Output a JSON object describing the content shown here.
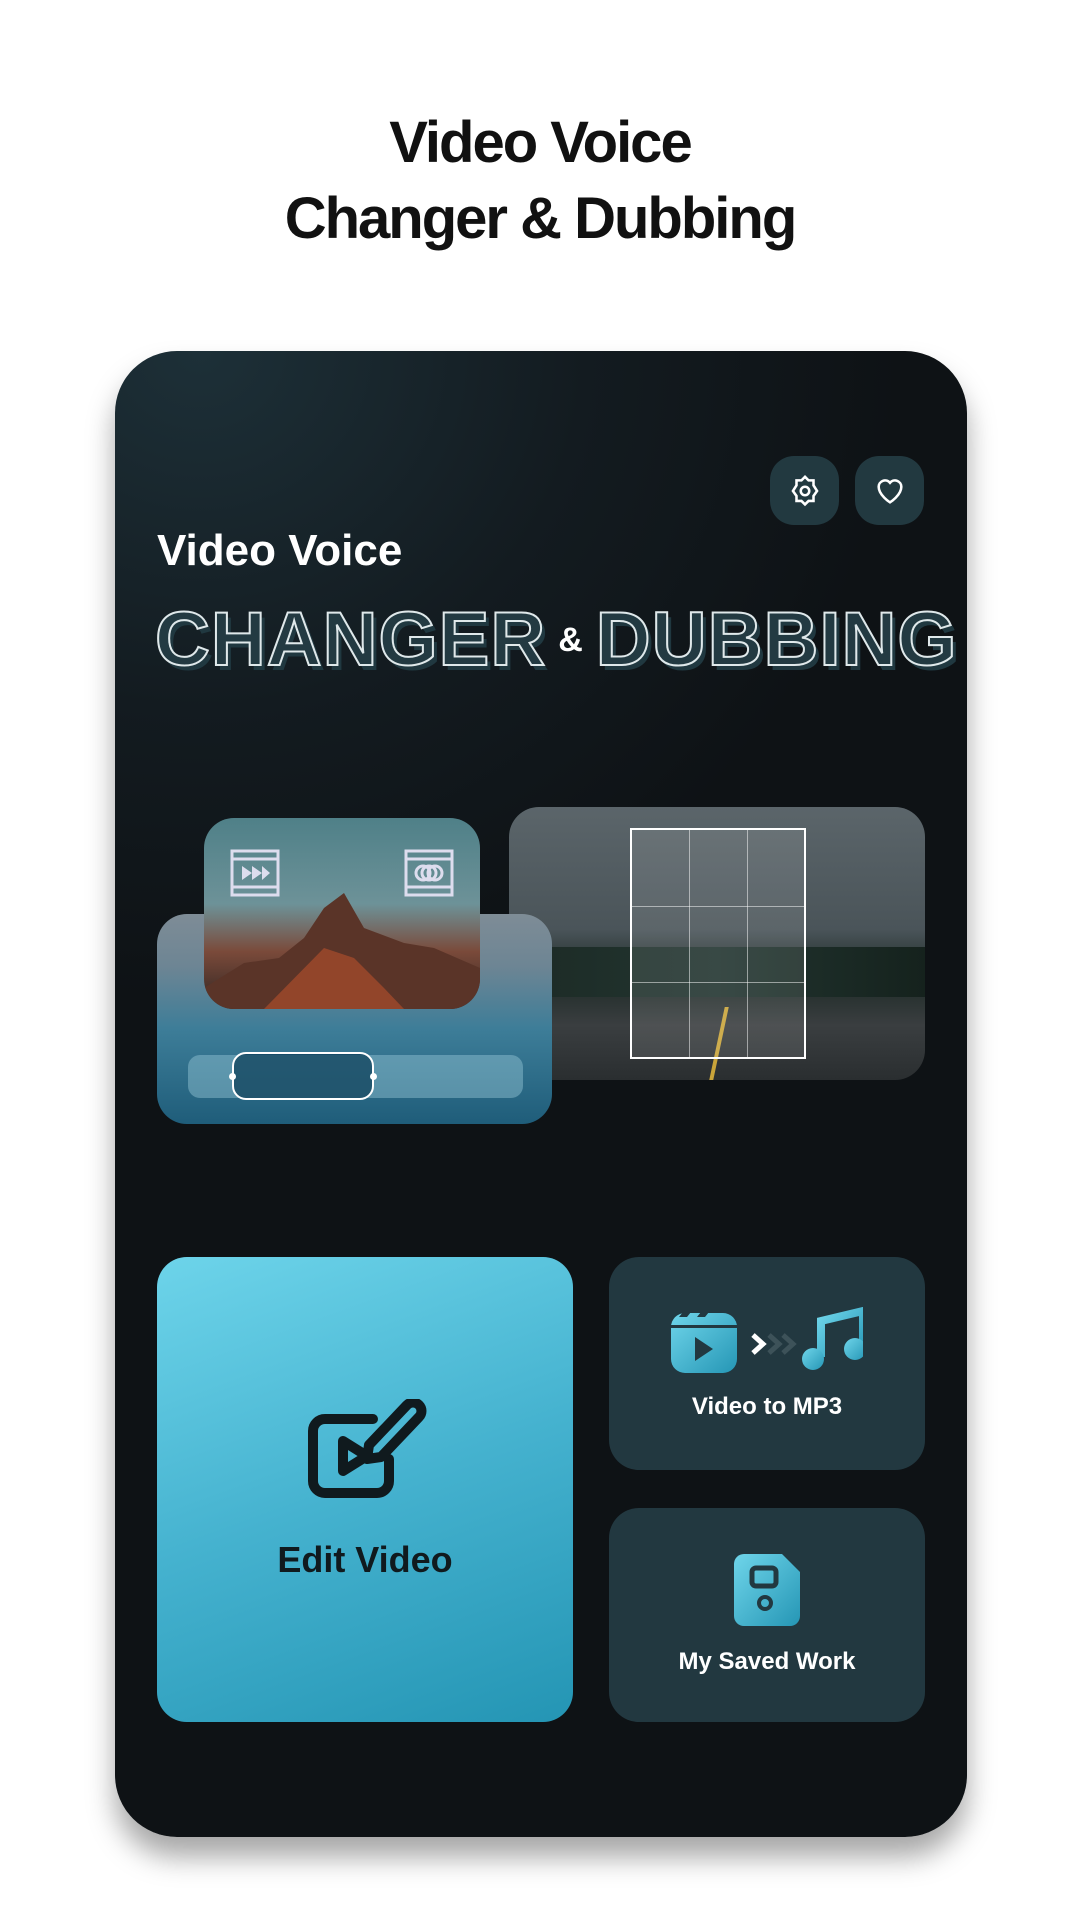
{
  "headline": {
    "line1": "Video Voice",
    "line2": "Changer & Dubbing"
  },
  "app": {
    "title_line1": "Video Voice",
    "title_word1": "CHANGER",
    "title_amp": "&",
    "title_word2": "DUBBING",
    "buttons": {
      "settings": "gear-icon",
      "favorite": "heart-icon"
    },
    "tiles": {
      "edit_video": "Edit Video",
      "video_to_mp3": "Video to MP3",
      "saved_work": "My Saved Work"
    }
  },
  "colors": {
    "accent": "#4fc0db",
    "tile_bg": "#223840",
    "background": "#0e1215"
  }
}
